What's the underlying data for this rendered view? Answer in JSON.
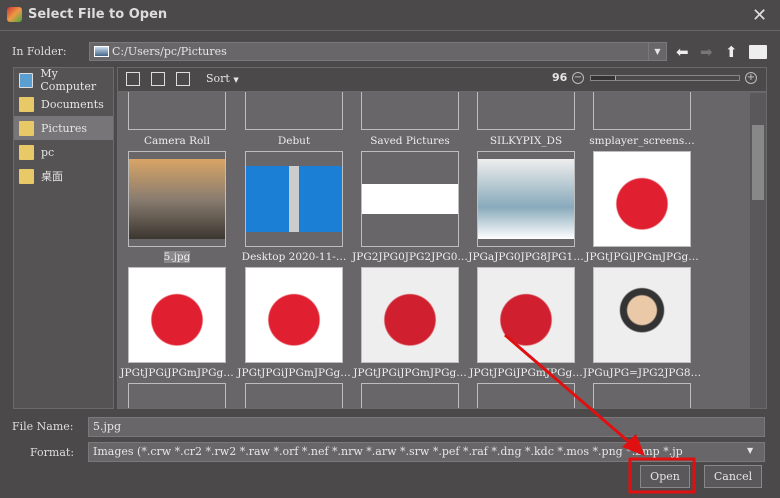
{
  "title": "Select File to Open",
  "in_folder_label": "In Folder:",
  "folder_path": "C:/Users/pc/Pictures",
  "sidebar": [
    {
      "label": "My Computer",
      "icon": "computer-icon"
    },
    {
      "label": "Documents",
      "icon": "folder-documents-icon"
    },
    {
      "label": "Pictures",
      "icon": "folder-pictures-icon",
      "selected": true
    },
    {
      "label": "pc",
      "icon": "folder-user-icon"
    },
    {
      "label": "桌面",
      "icon": "folder-desktop-icon"
    }
  ],
  "toolbar": {
    "sort_label": "Sort",
    "zoom_value": "96",
    "zoom_fraction": 0.17
  },
  "folders": [
    "Camera Roll",
    "Debut",
    "Saved Pictures",
    "SILKYPIX_DS",
    "smplayer_screens…"
  ],
  "row2": [
    "5.jpg",
    "Desktop 2020-11-…",
    "JPG2JPG0JPG2JPG0…",
    "JPGaJPG0JPG8JPG1…",
    "JPGtJPGiJPGmJPGg…"
  ],
  "row3": [
    "JPGtJPGiJPGmJPGg…",
    "JPGtJPGiJPGmJPGg…",
    "JPGtJPGiJPGmJPGg…",
    "JPGtJPGiJPGmJPGg…",
    "JPGuJPG=JPG2JPG8…"
  ],
  "file_name_label": "File Name:",
  "file_name": "5.jpg",
  "format_label": "Format:",
  "format": "Images (*.crw *.cr2 *.rw2 *.raw *.orf *.nef *.nrw *.arw *.srw *.pef *.raf *.dng *.kdc *.mos *.png *.bmp *.jp",
  "open_label": "Open",
  "cancel_label": "Cancel",
  "annotation_color": "#e01010"
}
